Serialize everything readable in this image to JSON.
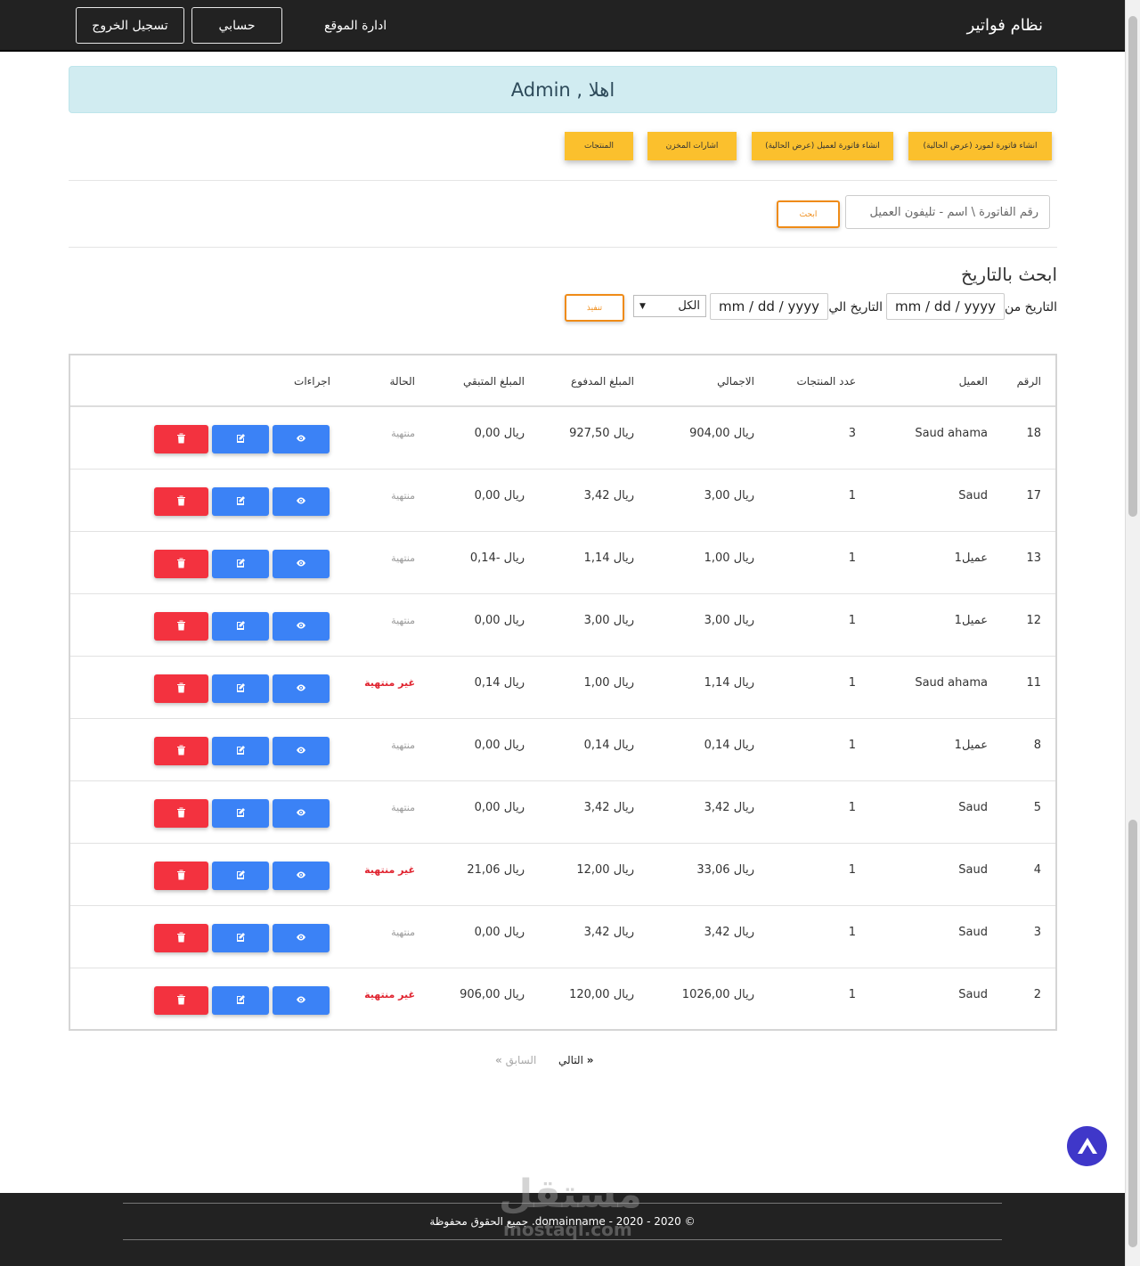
{
  "navbar": {
    "brand": "نظام فواتير",
    "site_admin": "ادارة الموقع",
    "account": "حسابي",
    "logout": "تسجيل الخروج"
  },
  "welcome": "اهلا , Admin",
  "quick_actions": [
    "انشاء فاتورة لمورد (عرض الحالية)",
    "انشاء فاتورة لعميل (عرض الحالية)",
    "اشارات المخزن",
    "المنتجات"
  ],
  "search": {
    "placeholder": "رقم الفاتورة \\ اسم - تليفون العميل",
    "button": "ابحث"
  },
  "date_search": {
    "title": "ابحث بالتاريخ",
    "from_label": "التاريخ من",
    "to_label": "التاريخ الي",
    "from_value": "mm / dd / yyyy",
    "to_value": "mm / dd / yyyy",
    "filter_value": "الكل",
    "run_button": "تنفيذ"
  },
  "table": {
    "headers": {
      "num": "الرقم",
      "customer": "العميل",
      "count": "عدد المنتجات",
      "total": "الاجمالي",
      "paid": "المبلغ المدفوع",
      "remaining": "المبلغ المتبقي",
      "status": "الحالة",
      "actions": "اجراءات"
    },
    "rows": [
      {
        "num": "18",
        "customer": "Saud ahama",
        "count": "3",
        "total": "ريال 904,00",
        "paid": "ريال 927,50",
        "remaining": "ريال 0,00",
        "status": "منتهية",
        "done": true
      },
      {
        "num": "17",
        "customer": "Saud",
        "count": "1",
        "total": "ريال 3,00",
        "paid": "ريال 3,42",
        "remaining": "ريال 0,00",
        "status": "منتهية",
        "done": true
      },
      {
        "num": "13",
        "customer": "عميل1",
        "count": "1",
        "total": "ريال 1,00",
        "paid": "ريال 1,14",
        "remaining": "ريال -0,14",
        "status": "منتهية",
        "done": true
      },
      {
        "num": "12",
        "customer": "عميل1",
        "count": "1",
        "total": "ريال 3,00",
        "paid": "ريال 3,00",
        "remaining": "ريال 0,00",
        "status": "منتهية",
        "done": true
      },
      {
        "num": "11",
        "customer": "Saud ahama",
        "count": "1",
        "total": "ريال 1,14",
        "paid": "ريال 1,00",
        "remaining": "ريال 0,14",
        "status": "غير منتهية",
        "done": false
      },
      {
        "num": "8",
        "customer": "عميل1",
        "count": "1",
        "total": "ريال 0,14",
        "paid": "ريال 0,14",
        "remaining": "ريال 0,00",
        "status": "منتهية",
        "done": true
      },
      {
        "num": "5",
        "customer": "Saud",
        "count": "1",
        "total": "ريال 3,42",
        "paid": "ريال 3,42",
        "remaining": "ريال 0,00",
        "status": "منتهية",
        "done": true
      },
      {
        "num": "4",
        "customer": "Saud",
        "count": "1",
        "total": "ريال 33,06",
        "paid": "ريال 12,00",
        "remaining": "ريال 21,06",
        "status": "غير منتهية",
        "done": false
      },
      {
        "num": "3",
        "customer": "Saud",
        "count": "1",
        "total": "ريال 3,42",
        "paid": "ريال 3,42",
        "remaining": "ريال 0,00",
        "status": "منتهية",
        "done": true
      },
      {
        "num": "2",
        "customer": "Saud",
        "count": "1",
        "total": "ريال 1026,00",
        "paid": "ريال 120,00",
        "remaining": "ريال 906,00",
        "status": "غير منتهية",
        "done": false
      }
    ]
  },
  "pagination": {
    "next": "التالي",
    "prev": "السابق"
  },
  "footer": {
    "text": "© 2020 - 2020 - domainname. جميع الحقوق محفوظة"
  },
  "watermark": {
    "arabic": "مستقل",
    "latin": "mostaql.com"
  },
  "icons": {
    "view": "eye-icon",
    "edit": "edit-icon",
    "delete": "trash-icon",
    "next": "double-chevron-left-icon",
    "prev": "double-chevron-right-icon",
    "to_top": "chevron-up-icon"
  },
  "colors": {
    "accent": "#fbc02d",
    "outline_btn": "#ef8b17",
    "action_blue": "#3b82f6",
    "action_red": "#f3323f",
    "status_open": "#e0232f",
    "welcome_bg": "#d1ecf1"
  }
}
